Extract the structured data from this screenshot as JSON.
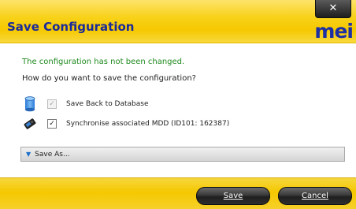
{
  "window": {
    "title": "Save Configuration",
    "brand": "mei",
    "close_glyph": "✕"
  },
  "content": {
    "message_status": "The configuration has not been changed.",
    "message_question": "How do you want to save the configuration?",
    "options": [
      {
        "label": "Save Back to Database",
        "checked": true,
        "enabled": false,
        "icon": "database-icon"
      },
      {
        "label": "Synchronise associated MDD (ID101: 162387)",
        "checked": true,
        "enabled": true,
        "icon": "device-icon"
      }
    ],
    "save_as": {
      "label": "Save As...",
      "icon": "chevron-down-icon"
    }
  },
  "footer": {
    "save_label": "Save",
    "cancel_label": "Cancel"
  },
  "colors": {
    "brand_yellow": "#f5c800",
    "title_blue": "#1a2a9a",
    "status_green": "#1f8a1f"
  }
}
